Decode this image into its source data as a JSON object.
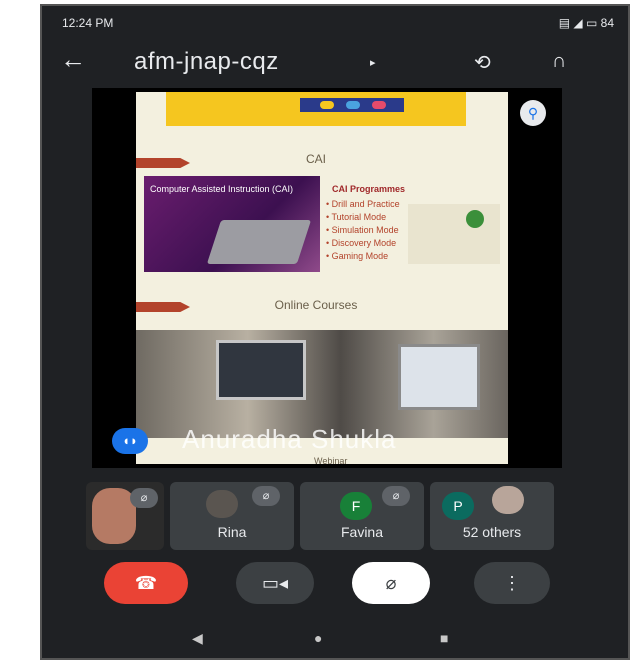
{
  "status": {
    "time": "12:24 PM",
    "right": "84"
  },
  "topbar": {
    "meeting_code": "afm-jnap-cqz"
  },
  "slide": {
    "section1_title": "CAI",
    "image_caption": "Computer Assisted Instruction (CAI)",
    "programmes_title": "CAI Programmes",
    "programmes": [
      "Drill and Practice",
      "Tutorial Mode",
      "Simulation Mode",
      "Discovery Mode",
      "Gaming Mode"
    ],
    "section2_title": "Online Courses",
    "footer_text": "Webinar"
  },
  "presenter": {
    "name": "Anuradha Shukla"
  },
  "participants": [
    {
      "name": "Rina",
      "initial": ""
    },
    {
      "name": "Favina",
      "initial": "F"
    },
    {
      "name": "52 others",
      "initial": "P"
    }
  ],
  "colors": {
    "end_call": "#ea4335",
    "accent": "#1a73e8",
    "background": "#1f2124"
  }
}
